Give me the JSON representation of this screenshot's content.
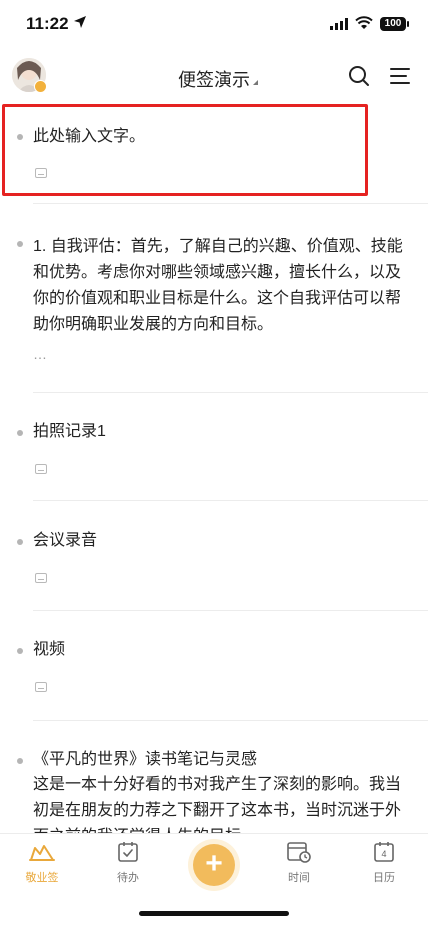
{
  "status_bar": {
    "time": "11:22",
    "battery": "100"
  },
  "header": {
    "title": "便签演示"
  },
  "notes": [
    {
      "text": "此处输入文字。",
      "highlighted": true
    },
    {
      "text": "1. 自我评估：首先，了解自己的兴趣、价值观、技能和优势。考虑你对哪些领域感兴趣，擅长什么，以及你的价值观和职业目标是什么。这个自我评估可以帮助你明确职业发展的方向和目标。",
      "more": "…"
    },
    {
      "text": "拍照记录1"
    },
    {
      "text": "会议录音"
    },
    {
      "text": "视频"
    },
    {
      "text": "《平凡的世界》读书笔记与灵感",
      "body": "这是一本十分好看的书对我产生了深刻的影响。我当初是在朋友的力荐之下翻开了这本书，当时沉迷于外面之前的我还觉得人生的目标"
    }
  ],
  "tabbar": {
    "items": [
      {
        "label": "敬业签",
        "active": true
      },
      {
        "label": "待办"
      },
      {
        "label": ""
      },
      {
        "label": "时间"
      },
      {
        "label": "日历"
      }
    ],
    "calendar_day": "4",
    "accent_color": "#e9a83b"
  }
}
